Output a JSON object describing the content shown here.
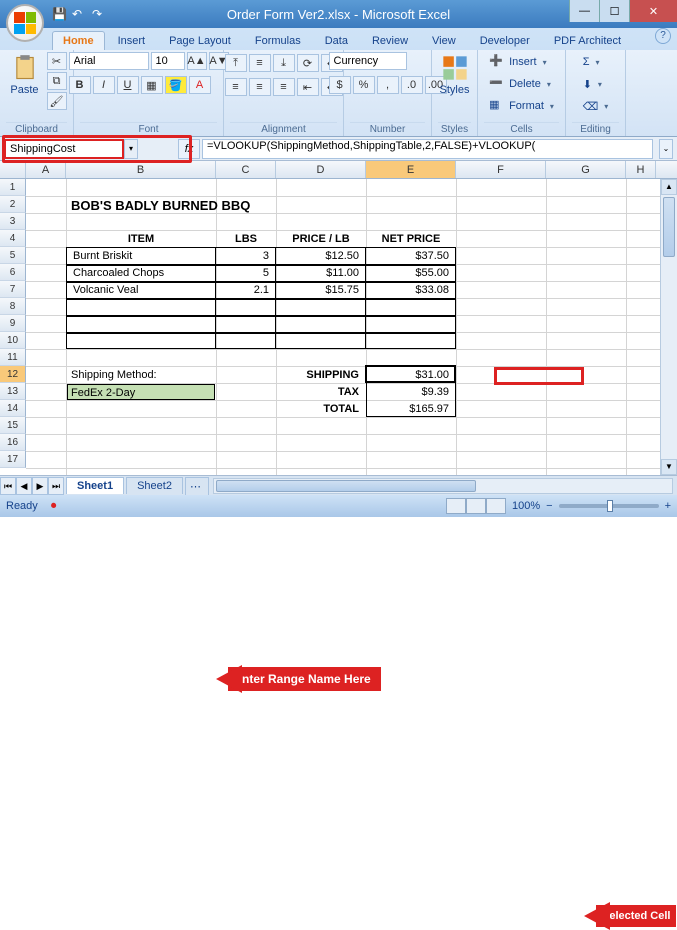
{
  "window": {
    "title": "Order Form Ver2.xlsx - Microsoft Excel",
    "help": "?"
  },
  "qat": {
    "save": "💾",
    "undo": "↶",
    "redo": "↷"
  },
  "tabs": {
    "items": [
      "Home",
      "Insert",
      "Page Layout",
      "Formulas",
      "Data",
      "Review",
      "View",
      "Developer",
      "PDF Architect"
    ],
    "active": 0
  },
  "ribbon": {
    "clipboard": {
      "label": "Clipboard",
      "paste": "Paste"
    },
    "font": {
      "label": "Font",
      "name": "Arial",
      "size": "10",
      "bold": "B",
      "italic": "I",
      "underline": "U"
    },
    "alignment": {
      "label": "Alignment"
    },
    "number": {
      "label": "Number",
      "format": "Currency"
    },
    "styles": {
      "label": "Styles",
      "btn": "Styles"
    },
    "cells": {
      "label": "Cells",
      "insert": "Insert",
      "delete": "Delete",
      "format": "Format"
    },
    "editing": {
      "label": "Editing"
    }
  },
  "formula_bar": {
    "name_box": "ShippingCost",
    "fx": "fx",
    "formula": "=VLOOKUP(ShippingMethod,ShippingTable,2,FALSE)+VLOOKUP("
  },
  "columns": [
    "A",
    "B",
    "C",
    "D",
    "E",
    "F",
    "G",
    "H"
  ],
  "rows": [
    "1",
    "2",
    "3",
    "4",
    "5",
    "6",
    "7",
    "8",
    "9",
    "10",
    "11",
    "12",
    "13",
    "14",
    "15",
    "16",
    "17"
  ],
  "selected": {
    "col": "E",
    "row": "12"
  },
  "cells": {
    "title": "BOB'S BADLY BURNED BBQ",
    "hdr_item": "ITEM",
    "hdr_lbs": "LBS",
    "hdr_price": "PRICE / LB",
    "hdr_net": "NET PRICE",
    "r5_item": "Burnt Briskit",
    "r5_lbs": "3",
    "r5_price": "$12.50",
    "r5_net": "$37.50",
    "r6_item": "Charcoaled Chops",
    "r6_lbs": "5",
    "r6_price": "$11.00",
    "r6_net": "$55.00",
    "r7_item": "Volcanic Veal",
    "r7_lbs": "2.1",
    "r7_price": "$15.75",
    "r7_net": "$33.08",
    "ship_method_label": "Shipping Method:",
    "ship_method": "FedEx 2-Day",
    "lbl_shipping": "SHIPPING",
    "val_shipping": "$31.00",
    "lbl_tax": "TAX",
    "val_tax": "$9.39",
    "lbl_total": "TOTAL",
    "val_total": "$165.97"
  },
  "sheet_tabs": {
    "tabs": [
      "Sheet1",
      "Sheet2"
    ],
    "active": 0,
    "new": "⋯"
  },
  "status": {
    "left": "Ready",
    "record": "⏺",
    "zoom": "100%",
    "minus": "−",
    "plus": "+"
  },
  "annotations": {
    "name_box": "Enter Range Name Here",
    "selected": "Selected Cell"
  }
}
